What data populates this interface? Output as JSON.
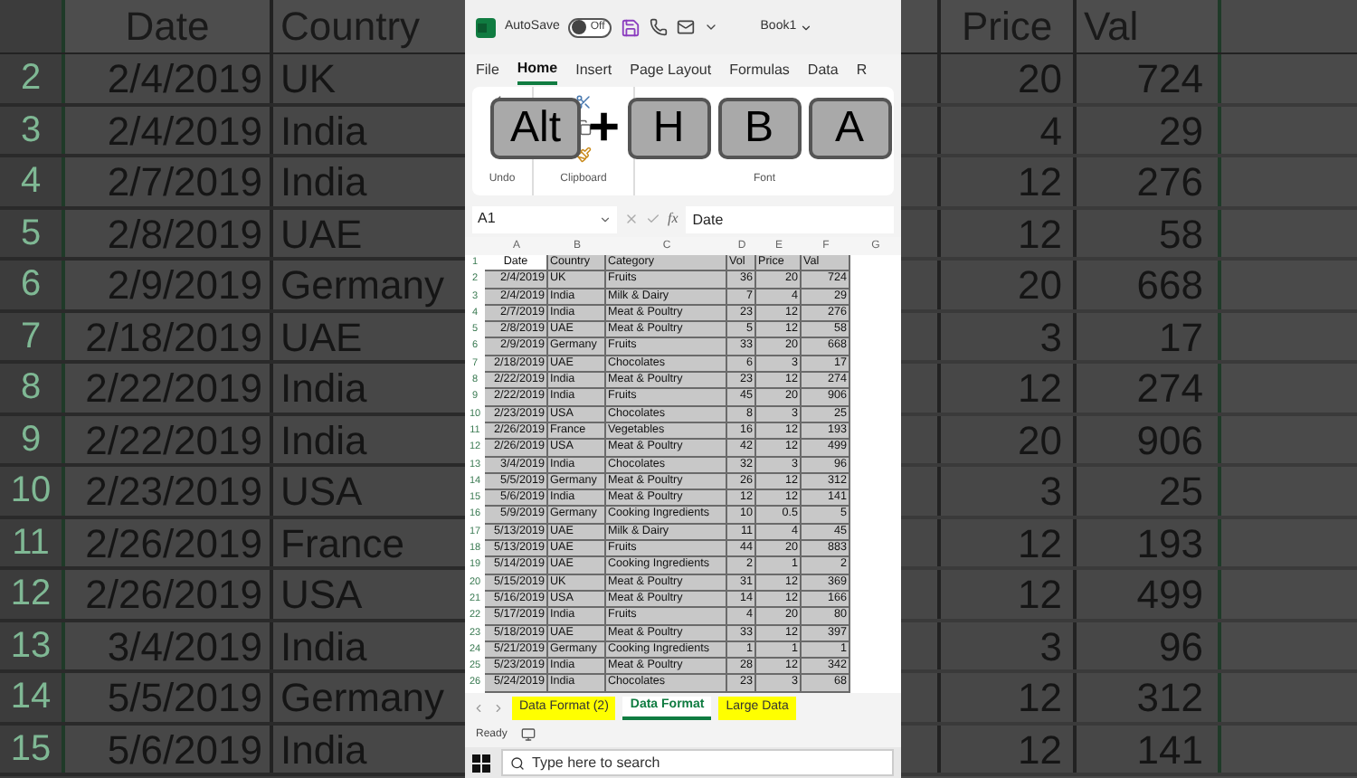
{
  "background_sheet": {
    "left_headers": [
      "Date",
      "Country"
    ],
    "right_headers": [
      "Price",
      "Val"
    ],
    "rows": [
      {
        "num": "2",
        "date": "2/4/2019",
        "country": "UK",
        "price": "20",
        "val": "724"
      },
      {
        "num": "3",
        "date": "2/4/2019",
        "country": "India",
        "price": "4",
        "val": "29"
      },
      {
        "num": "4",
        "date": "2/7/2019",
        "country": "India",
        "price": "12",
        "val": "276"
      },
      {
        "num": "5",
        "date": "2/8/2019",
        "country": "UAE",
        "price": "12",
        "val": "58"
      },
      {
        "num": "6",
        "date": "2/9/2019",
        "country": "Germany",
        "price": "20",
        "val": "668"
      },
      {
        "num": "7",
        "date": "2/18/2019",
        "country": "UAE",
        "price": "3",
        "val": "17"
      },
      {
        "num": "8",
        "date": "2/22/2019",
        "country": "India",
        "price": "12",
        "val": "274"
      },
      {
        "num": "9",
        "date": "2/22/2019",
        "country": "India",
        "price": "20",
        "val": "906"
      },
      {
        "num": "10",
        "date": "2/23/2019",
        "country": "USA",
        "price": "3",
        "val": "25"
      },
      {
        "num": "11",
        "date": "2/26/2019",
        "country": "France",
        "price": "12",
        "val": "193"
      },
      {
        "num": "12",
        "date": "2/26/2019",
        "country": "USA",
        "price": "12",
        "val": "499"
      },
      {
        "num": "13",
        "date": "3/4/2019",
        "country": "India",
        "price": "3",
        "val": "96"
      },
      {
        "num": "14",
        "date": "5/5/2019",
        "country": "Germany",
        "price": "12",
        "val": "312"
      },
      {
        "num": "15",
        "date": "5/6/2019",
        "country": "India",
        "price": "12",
        "val": "141"
      }
    ]
  },
  "excel": {
    "title_bar": {
      "autosave": "AutoSave",
      "autosave_on": false,
      "toggle_text": "Off",
      "book": "Book1"
    },
    "tabs": [
      {
        "label": "File",
        "selected": false
      },
      {
        "label": "Home",
        "selected": true
      },
      {
        "label": "Insert",
        "selected": false
      },
      {
        "label": "Page Layout",
        "selected": false
      },
      {
        "label": "Formulas",
        "selected": false
      },
      {
        "label": "Data",
        "selected": false
      },
      {
        "label": "R",
        "selected": false
      }
    ],
    "ribbon_groups": [
      "Undo",
      "Clipboard",
      "Font"
    ],
    "keys": [
      {
        "kind": "key",
        "label": "Alt"
      },
      {
        "kind": "plus",
        "label": "+"
      },
      {
        "kind": "key",
        "label": "H"
      },
      {
        "kind": "key",
        "label": "B"
      },
      {
        "kind": "key",
        "label": "A"
      }
    ],
    "name_box": "A1",
    "fx_label": "fx",
    "formula": "Date",
    "column_headers": [
      "A",
      "B",
      "C",
      "D",
      "E",
      "F",
      "G"
    ],
    "rows": [
      {
        "num": "1",
        "selected": true,
        "cells": [
          "Date",
          "Country",
          "Category",
          "Vol",
          "Price",
          "Val"
        ]
      },
      {
        "num": "2",
        "selected": true,
        "cells": [
          "2/4/2019",
          "UK",
          "Fruits",
          "36",
          "20",
          "724"
        ]
      },
      {
        "num": "3",
        "selected": true,
        "cells": [
          "2/4/2019",
          "India",
          "Milk & Dairy",
          "7",
          "4",
          "29"
        ]
      },
      {
        "num": "4",
        "selected": true,
        "cells": [
          "2/7/2019",
          "India",
          "Meat & Poultry",
          "23",
          "12",
          "276"
        ]
      },
      {
        "num": "5",
        "selected": true,
        "cells": [
          "2/8/2019",
          "UAE",
          "Meat & Poultry",
          "5",
          "12",
          "58"
        ]
      },
      {
        "num": "6",
        "selected": true,
        "cells": [
          "2/9/2019",
          "Germany",
          "Fruits",
          "33",
          "20",
          "668"
        ]
      },
      {
        "num": "7",
        "selected": true,
        "cells": [
          "2/18/2019",
          "UAE",
          "Chocolates",
          "6",
          "3",
          "17"
        ]
      },
      {
        "num": "8",
        "selected": true,
        "cells": [
          "2/22/2019",
          "India",
          "Meat & Poultry",
          "23",
          "12",
          "274"
        ]
      },
      {
        "num": "9",
        "selected": true,
        "cells": [
          "2/22/2019",
          "India",
          "Fruits",
          "45",
          "20",
          "906"
        ]
      },
      {
        "num": "10",
        "selected": true,
        "cells": [
          "2/23/2019",
          "USA",
          "Chocolates",
          "8",
          "3",
          "25"
        ]
      },
      {
        "num": "11",
        "selected": true,
        "cells": [
          "2/26/2019",
          "France",
          "Vegetables",
          "16",
          "12",
          "193"
        ]
      },
      {
        "num": "12",
        "selected": true,
        "cells": [
          "2/26/2019",
          "USA",
          "Meat & Poultry",
          "42",
          "12",
          "499"
        ]
      },
      {
        "num": "13",
        "selected": true,
        "cells": [
          "3/4/2019",
          "India",
          "Chocolates",
          "32",
          "3",
          "96"
        ]
      },
      {
        "num": "14",
        "selected": true,
        "cells": [
          "5/5/2019",
          "Germany",
          "Meat & Poultry",
          "26",
          "12",
          "312"
        ]
      },
      {
        "num": "15",
        "selected": true,
        "cells": [
          "5/6/2019",
          "India",
          "Meat & Poultry",
          "12",
          "12",
          "141"
        ]
      },
      {
        "num": "16",
        "selected": true,
        "cells": [
          "5/9/2019",
          "Germany",
          "Cooking Ingredients",
          "10",
          "0.5",
          "5"
        ]
      },
      {
        "num": "17",
        "selected": true,
        "cells": [
          "5/13/2019",
          "UAE",
          "Milk & Dairy",
          "11",
          "4",
          "45"
        ]
      },
      {
        "num": "18",
        "selected": true,
        "cells": [
          "5/13/2019",
          "UAE",
          "Fruits",
          "44",
          "20",
          "883"
        ]
      },
      {
        "num": "19",
        "selected": true,
        "cells": [
          "5/14/2019",
          "UAE",
          "Cooking Ingredients",
          "2",
          "1",
          "2"
        ]
      },
      {
        "num": "20",
        "selected": true,
        "cells": [
          "5/15/2019",
          "UK",
          "Meat & Poultry",
          "31",
          "12",
          "369"
        ]
      },
      {
        "num": "21",
        "selected": true,
        "cells": [
          "5/16/2019",
          "USA",
          "Meat & Poultry",
          "14",
          "12",
          "166"
        ]
      },
      {
        "num": "22",
        "selected": true,
        "cells": [
          "5/17/2019",
          "India",
          "Fruits",
          "4",
          "20",
          "80"
        ]
      },
      {
        "num": "23",
        "selected": true,
        "cells": [
          "5/18/2019",
          "UAE",
          "Meat & Poultry",
          "33",
          "12",
          "397"
        ]
      },
      {
        "num": "24",
        "selected": true,
        "cells": [
          "5/21/2019",
          "Germany",
          "Cooking Ingredients",
          "1",
          "1",
          "1"
        ]
      },
      {
        "num": "25",
        "selected": true,
        "cells": [
          "5/23/2019",
          "India",
          "Meat & Poultry",
          "28",
          "12",
          "342"
        ]
      },
      {
        "num": "26",
        "selected": true,
        "cells": [
          "5/24/2019",
          "India",
          "Chocolates",
          "23",
          "3",
          "68"
        ]
      }
    ],
    "sheet_tabs": [
      {
        "label": "Data Format (2)",
        "selected": false,
        "highlighted": true
      },
      {
        "label": "Data Format",
        "selected": true,
        "highlighted": false
      },
      {
        "label": "Large Data",
        "selected": false,
        "highlighted": true
      }
    ],
    "status": "Ready",
    "taskbar": {
      "search_placeholder": "Type here to search"
    }
  }
}
